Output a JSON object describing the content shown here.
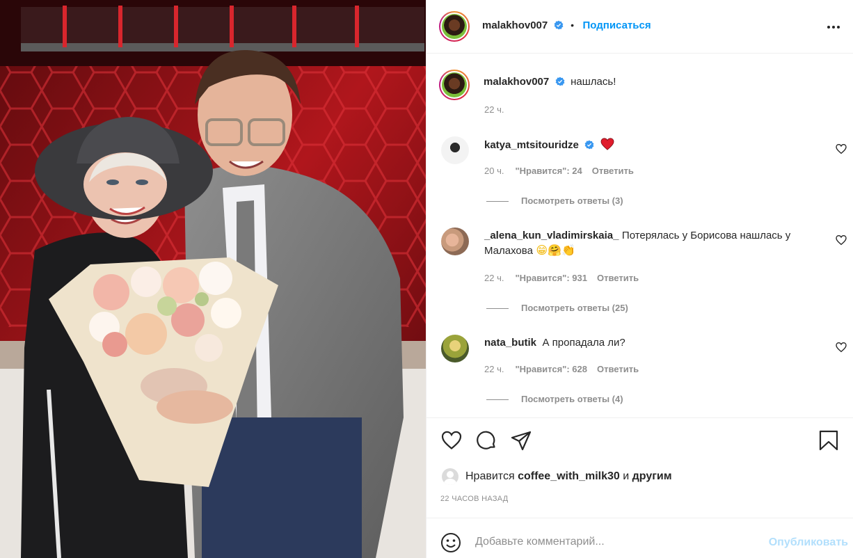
{
  "post": {
    "author": "malakhov007",
    "follow_label": "Подписаться",
    "separator": "•",
    "caption": "нашлась!",
    "caption_time": "22 ч."
  },
  "comments": [
    {
      "username": "katya_mtsitouridze",
      "verified": true,
      "text": "",
      "emoji": "heart-emoji",
      "time": "20 ч.",
      "likes": "\"Нравится\": 24",
      "reply": "Ответить",
      "view_replies": "Посмотреть ответы (3)"
    },
    {
      "username": "_alena_kun_vladimirskaia_",
      "verified": false,
      "text": "Потерялась у Борисова нашлась у Малахова",
      "emoji": "grin-hug-clap-emojis",
      "time": "22 ч.",
      "likes": "\"Нравится\": 931",
      "reply": "Ответить",
      "view_replies": "Посмотреть ответы (25)"
    },
    {
      "username": "nata_butik",
      "verified": false,
      "text": "А пропадала ли?",
      "time": "22 ч.",
      "likes": "\"Нравится\": 628",
      "reply": "Ответить",
      "view_replies": "Посмотреть ответы (4)"
    }
  ],
  "likes_summary": {
    "prefix": "Нравится",
    "user": "coffee_with_milk30",
    "conj": "и",
    "others": "другим"
  },
  "posted_ago": "22 ЧАСОВ НАЗАД",
  "comment_box": {
    "placeholder": "Добавьте комментарий...",
    "publish_label": "Опубликовать"
  },
  "colors": {
    "link_blue": "#0095f6",
    "publish_disabled": "#b2dffc",
    "muted": "#8e8e8e",
    "verified_blue": "#3897f0",
    "heart_red": "#ed4956"
  },
  "icons": [
    "more-icon",
    "verified-icon",
    "heart-icon",
    "comment-icon",
    "share-icon",
    "bookmark-icon",
    "emoji-icon"
  ]
}
